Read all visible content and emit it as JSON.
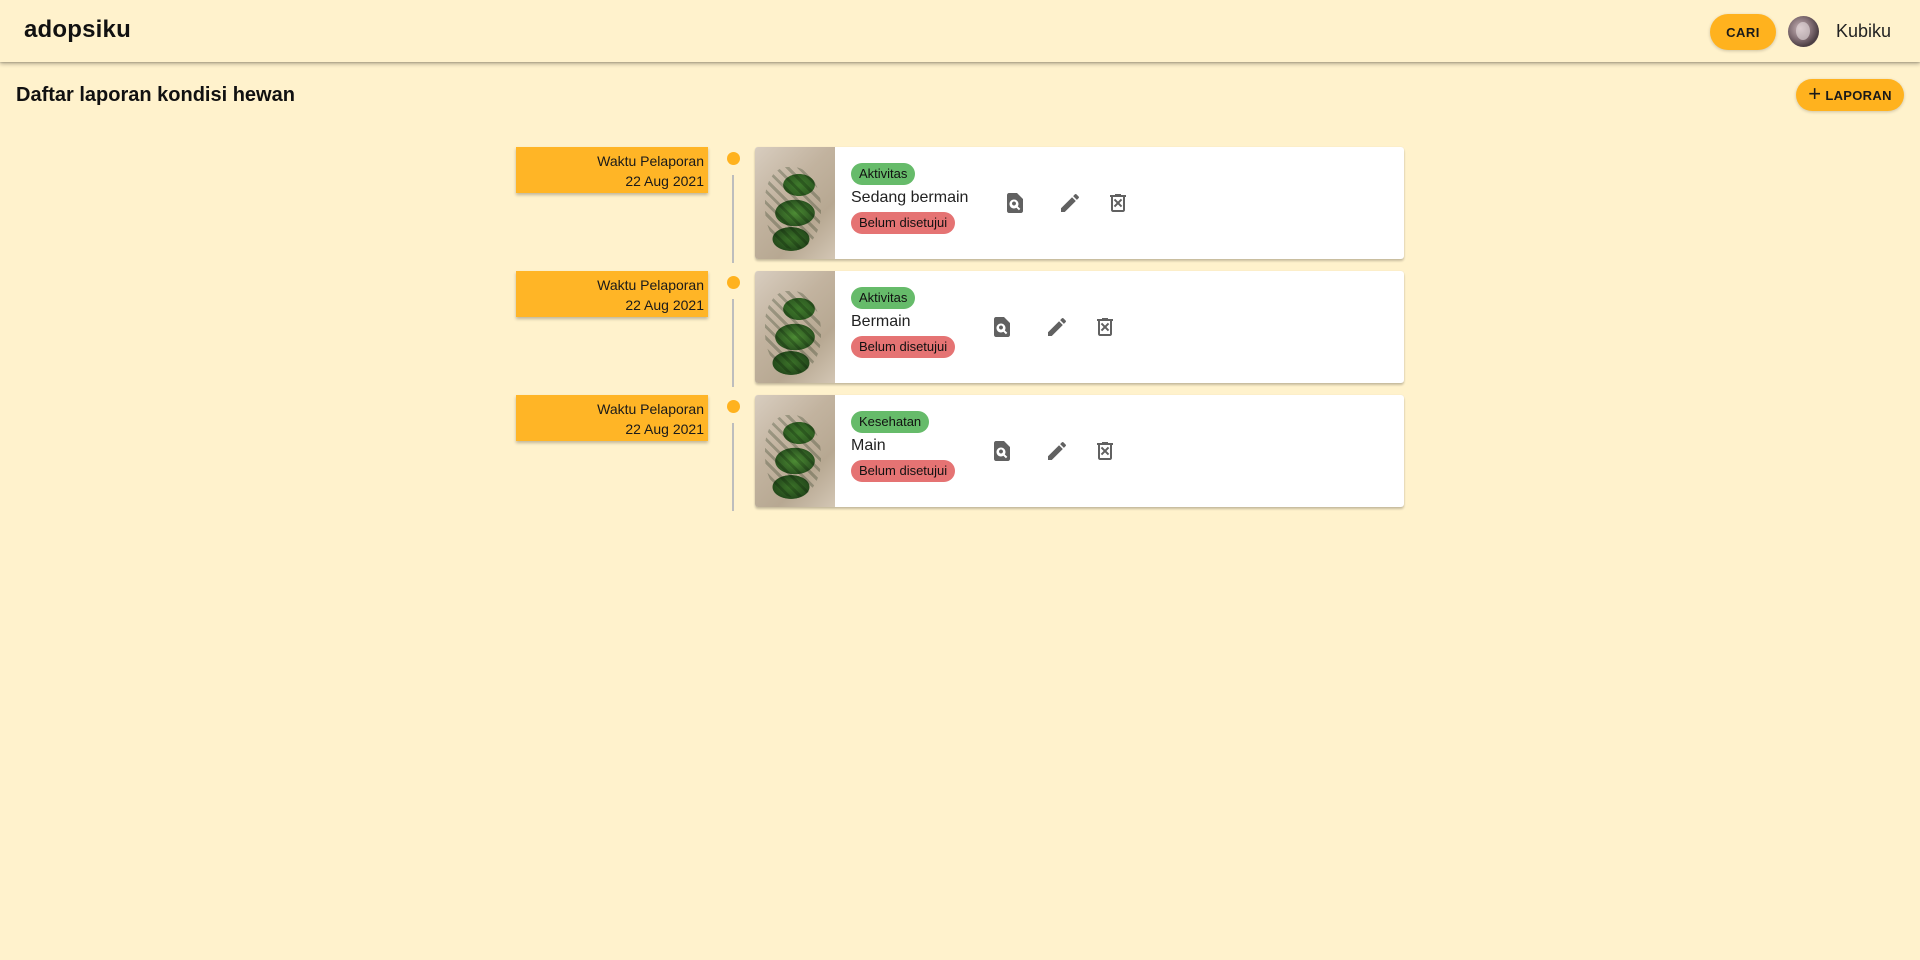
{
  "header": {
    "brand": "adopsiku",
    "search_label": "CARI",
    "user_name": "Kubiku"
  },
  "page": {
    "title": "Daftar laporan kondisi hewan",
    "add_button_label": "LAPORAN"
  },
  "reports": [
    {
      "time_label": "Waktu Pelaporan",
      "date": "22 Aug 2021",
      "category": "Aktivitas",
      "title": "Sedang bermain",
      "status": "Belum disetujui"
    },
    {
      "time_label": "Waktu Pelaporan",
      "date": "22 Aug 2021",
      "category": "Aktivitas",
      "title": "Bermain",
      "status": "Belum disetujui"
    },
    {
      "time_label": "Waktu Pelaporan",
      "date": "22 Aug 2021",
      "category": "Kesehatan",
      "title": "Main",
      "status": "Belum disetujui"
    }
  ],
  "icons": {
    "view": "search-document-icon",
    "edit": "pencil-icon",
    "delete": "delete-icon",
    "add": "plus-icon"
  },
  "colors": {
    "background": "#fff2cc",
    "accent": "#ffb21e",
    "category_chip": "#66bb6a",
    "status_chip": "#e57373",
    "icon": "#616161"
  }
}
